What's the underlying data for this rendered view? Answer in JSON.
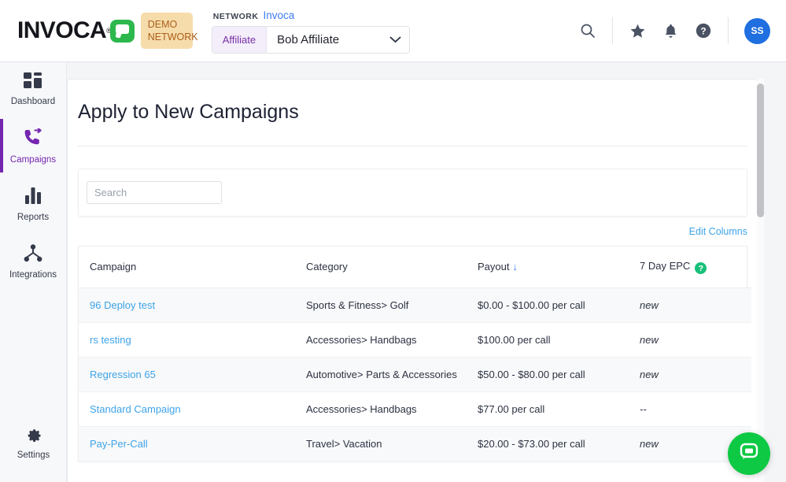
{
  "header": {
    "logo_word": "INVOCA",
    "logo_icon": "speech-bubble-icon",
    "demo_badge": "DEMO NETWORK",
    "network_label": "NETWORK",
    "network_value": "Invoca",
    "affiliate_tag": "Affiliate",
    "affiliate_value": "Bob Affiliate",
    "avatar_initials": "SS",
    "icons": [
      "search-icon",
      "star-icon",
      "bell-icon",
      "help-icon"
    ]
  },
  "sidebar": {
    "items": [
      {
        "label": "Dashboard",
        "icon": "dashboard-icon",
        "active": false
      },
      {
        "label": "Campaigns",
        "icon": "call-forward-icon",
        "active": true
      },
      {
        "label": "Reports",
        "icon": "bar-chart-icon",
        "active": false
      },
      {
        "label": "Integrations",
        "icon": "node-tree-icon",
        "active": false
      }
    ],
    "settings": {
      "label": "Settings",
      "icon": "gear-icon"
    }
  },
  "main": {
    "page_title": "Apply to New Campaigns",
    "search_placeholder": "Search",
    "search_value": "",
    "edit_columns_label": "Edit Columns",
    "table": {
      "headers": {
        "campaign": "Campaign",
        "category": "Category",
        "payout": "Payout",
        "payout_sort": "↓",
        "epc": "7 Day EPC",
        "epc_help": "?"
      },
      "rows": [
        {
          "campaign": "96 Deploy test",
          "category": "Sports & Fitness> Golf",
          "payout": "$0.00 - $100.00 per call",
          "epc": "new"
        },
        {
          "campaign": "rs testing",
          "category": "Accessories> Handbags",
          "payout": "$100.00 per call",
          "epc": "new"
        },
        {
          "campaign": "Regression 65",
          "category": "Automotive> Parts & Accessories",
          "payout": "$50.00 - $80.00 per call",
          "epc": "new"
        },
        {
          "campaign": "Standard Campaign",
          "category": "Accessories> Handbags",
          "payout": "$77.00 per call",
          "epc": "--"
        },
        {
          "campaign": "Pay-Per-Call",
          "category": "Travel> Vacation",
          "payout": "$20.00 - $73.00 per call",
          "epc": "new"
        }
      ]
    }
  },
  "chat": {
    "icon": "chat-bubble-icon"
  },
  "colors": {
    "accent_purple": "#7526b0",
    "link_blue": "#3da3e8",
    "brand_green": "#2db84d",
    "chat_green": "#0dc943",
    "badge_tan": "#f7dcab",
    "avatar_blue": "#1f6fe0"
  }
}
